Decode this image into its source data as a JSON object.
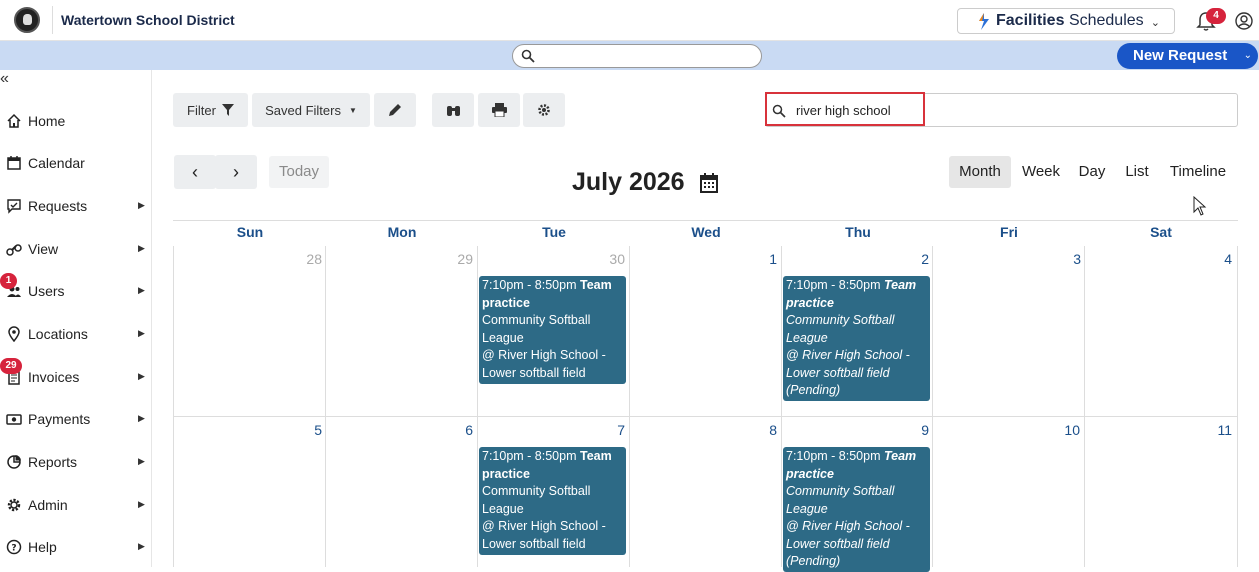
{
  "header": {
    "district_name": "Watertown School District",
    "brand_label": "Facilities",
    "brand_label_2": "Schedules",
    "notification_count": "4"
  },
  "bluebar": {
    "search_value": "",
    "new_request_label": "New Request"
  },
  "sidebar": {
    "items": [
      {
        "label": "Home",
        "icon": "home-icon"
      },
      {
        "label": "Calendar",
        "icon": "calendar-icon"
      },
      {
        "label": "Requests",
        "icon": "requests-icon"
      },
      {
        "label": "View",
        "icon": "binoculars-icon"
      },
      {
        "label": "Users",
        "icon": "users-icon",
        "badge": "1"
      },
      {
        "label": "Locations",
        "icon": "location-pin-icon"
      },
      {
        "label": "Invoices",
        "icon": "invoice-icon",
        "badge": "29"
      },
      {
        "label": "Payments",
        "icon": "payment-icon"
      },
      {
        "label": "Reports",
        "icon": "pie-chart-icon"
      },
      {
        "label": "Admin",
        "icon": "gear-icon"
      },
      {
        "label": "Help",
        "icon": "help-icon"
      }
    ]
  },
  "toolbar": {
    "filter_label": "Filter",
    "saved_filters_label": "Saved Filters",
    "search_value": "river high school"
  },
  "calendar": {
    "today_label": "Today",
    "title": "July 2026",
    "views": [
      "Month",
      "Week",
      "Day",
      "List",
      "Timeline"
    ],
    "active_view": "Month",
    "weekdays": [
      "Sun",
      "Mon",
      "Tue",
      "Wed",
      "Thu",
      "Fri",
      "Sat"
    ],
    "week1": [
      "28",
      "29",
      "30",
      "1",
      "2",
      "3",
      "4"
    ],
    "week2": [
      "5",
      "6",
      "7",
      "8",
      "9",
      "10",
      "11"
    ],
    "events": [
      {
        "time": "7:10pm - 8:50pm",
        "title": "Team practice",
        "org": "Community Softball League",
        "place": "@ River High School - Lower softball field",
        "status": ""
      },
      {
        "time": "7:10pm - 8:50pm",
        "title": "Team practice",
        "org": "Community Softball League",
        "place": "@ River High School - Lower softball field",
        "status": "(Pending)"
      },
      {
        "time": "7:10pm - 8:50pm",
        "title": "Team practice",
        "org": "Community Softball League",
        "place": "@ River High School - Lower softball field",
        "status": ""
      },
      {
        "time": "7:10pm - 8:50pm",
        "title": "Team practice",
        "org": "Community Softball League",
        "place": "@ River High School - Lower softball field",
        "status": "(Pending)"
      }
    ]
  },
  "colors": {
    "accent": "#1a56c7",
    "event_bg": "#2d6a86",
    "badge": "#d6233c",
    "highlight": "#d8323b",
    "bluebar": "#c9daf3"
  }
}
